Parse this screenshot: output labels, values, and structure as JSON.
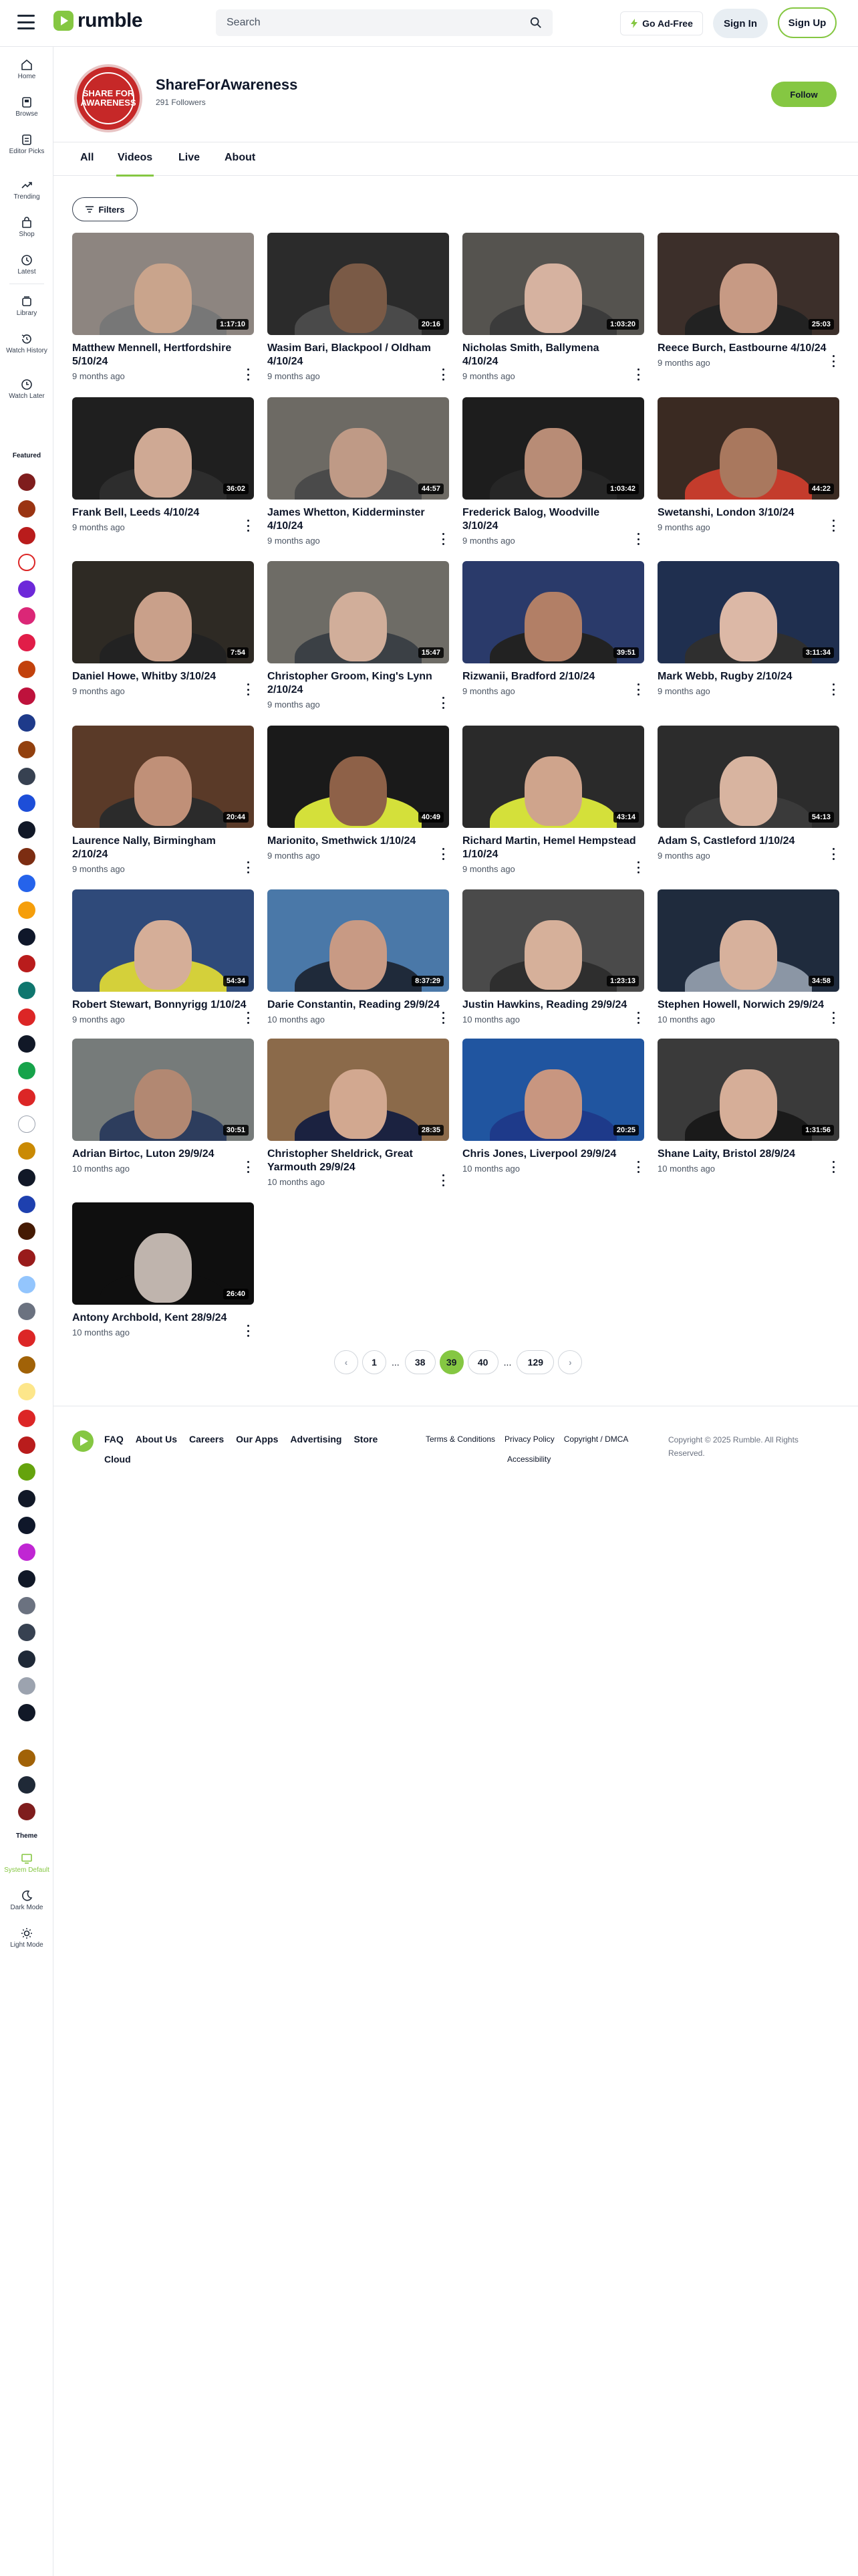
{
  "header": {
    "logo_text": "rumble",
    "search_placeholder": "Search",
    "go_ad_free": "Go Ad-Free",
    "sign_in": "Sign In",
    "sign_up": "Sign Up",
    "brand_color": "#85c742"
  },
  "sidebar": {
    "items": [
      {
        "label": "Home",
        "icon": "home-icon"
      },
      {
        "label": "Browse",
        "icon": "browse-icon"
      },
      {
        "label": "Editor Picks",
        "icon": "editor-picks-icon"
      },
      {
        "label": "Trending",
        "icon": "trending-icon"
      },
      {
        "label": "Shop",
        "icon": "shop-icon"
      },
      {
        "label": "Latest",
        "icon": "clock-icon"
      },
      {
        "label": "Library",
        "icon": "library-icon"
      },
      {
        "label": "Watch History",
        "icon": "history-icon"
      },
      {
        "label": "Watch Later",
        "icon": "watch-later-icon"
      }
    ],
    "featured_label": "Featured",
    "theme_label": "Theme",
    "theme_options": [
      {
        "label": "System Default",
        "icon": "system-theme-icon"
      },
      {
        "label": "Dark Mode",
        "icon": "moon-icon"
      },
      {
        "label": "Light Mode",
        "icon": "sun-icon"
      }
    ]
  },
  "channel": {
    "avatar_text": "SHARE FOR AWARENESS",
    "name": "ShareForAwareness",
    "followers": "291 Followers",
    "follow_label": "Follow",
    "tabs": [
      "All",
      "Videos",
      "Live",
      "About"
    ],
    "active_tab": "Videos",
    "filters_label": "Filters"
  },
  "videos": [
    {
      "title": "Matthew Mennell, Hertfordshire 5/10/24",
      "meta": "9 months ago",
      "duration": "1:17:10"
    },
    {
      "title": "Wasim Bari, Blackpool / Oldham 4/10/24",
      "meta": "9 months ago",
      "duration": "20:16"
    },
    {
      "title": "Nicholas Smith, Ballymena 4/10/24",
      "meta": "9 months ago",
      "duration": "1:03:20"
    },
    {
      "title": "Reece Burch, Eastbourne 4/10/24",
      "meta": "9 months ago",
      "duration": "25:03"
    },
    {
      "title": "Frank Bell, Leeds 4/10/24",
      "meta": "9 months ago",
      "duration": "36:02"
    },
    {
      "title": "James Whetton, Kidderminster 4/10/24",
      "meta": "9 months ago",
      "duration": "44:57"
    },
    {
      "title": "Frederick Balog, Woodville 3/10/24",
      "meta": "9 months ago",
      "duration": "1:03:42"
    },
    {
      "title": "Swetanshi, London 3/10/24",
      "meta": "9 months ago",
      "duration": "44:22"
    },
    {
      "title": "Daniel Howe, Whitby 3/10/24",
      "meta": "9 months ago",
      "duration": "7:54"
    },
    {
      "title": "Christopher Groom, King's Lynn 2/10/24",
      "meta": "9 months ago",
      "duration": "15:47"
    },
    {
      "title": "Rizwanii, Bradford 2/10/24",
      "meta": "9 months ago",
      "duration": "39:51"
    },
    {
      "title": "Mark Webb, Rugby 2/10/24",
      "meta": "9 months ago",
      "duration": "3:11:34"
    },
    {
      "title": "Laurence Nally, Birmingham 2/10/24",
      "meta": "9 months ago",
      "duration": "20:44"
    },
    {
      "title": "Marionito, Smethwick 1/10/24",
      "meta": "9 months ago",
      "duration": "40:49"
    },
    {
      "title": "Richard Martin, Hemel Hempstead 1/10/24",
      "meta": "9 months ago",
      "duration": "43:14"
    },
    {
      "title": "Adam S, Castleford 1/10/24",
      "meta": "9 months ago",
      "duration": "54:13"
    },
    {
      "title": "Robert Stewart, Bonnyrigg 1/10/24",
      "meta": "9 months ago",
      "duration": "54:34"
    },
    {
      "title": "Darie Constantin, Reading 29/9/24",
      "meta": "10 months ago",
      "duration": "8:37:29"
    },
    {
      "title": "Justin Hawkins, Reading 29/9/24",
      "meta": "10 months ago",
      "duration": "1:23:13"
    },
    {
      "title": "Stephen Howell, Norwich 29/9/24",
      "meta": "10 months ago",
      "duration": "34:58"
    },
    {
      "title": "Adrian Birtoc, Luton 29/9/24",
      "meta": "10 months ago",
      "duration": "30:51"
    },
    {
      "title": "Christopher Sheldrick, Great Yarmouth 29/9/24",
      "meta": "10 months ago",
      "duration": "28:35"
    },
    {
      "title": "Chris Jones, Liverpool 29/9/24",
      "meta": "10 months ago",
      "duration": "20:25"
    },
    {
      "title": "Shane Laity, Bristol 28/9/24",
      "meta": "10 months ago",
      "duration": "1:31:56"
    },
    {
      "title": "Antony Archbold, Kent 28/9/24",
      "meta": "10 months ago",
      "duration": "26:40"
    }
  ],
  "pagination": {
    "prev": "‹",
    "next": "›",
    "pages": [
      "1",
      "...",
      "38",
      "39",
      "40",
      "...",
      "129"
    ],
    "current": "39"
  },
  "footer": {
    "links_primary": [
      "FAQ",
      "About Us",
      "Careers",
      "Our Apps",
      "Advertising",
      "Store",
      "Cloud"
    ],
    "links_secondary": [
      "Terms & Conditions",
      "Privacy Policy",
      "Copyright / DMCA",
      "Accessibility"
    ],
    "copyright": "Copyright © 2025 Rumble. All Rights Reserved."
  }
}
